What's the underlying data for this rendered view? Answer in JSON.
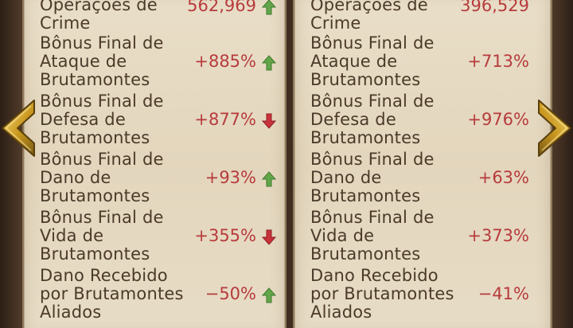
{
  "left_panel": {
    "rows": [
      {
        "label": "Operações de\nCrime",
        "value": "562,969",
        "trend": "up",
        "trend_icon": "green-up-arrow-icon"
      },
      {
        "label": "Bônus Final de\nAtaque de\nBrutamontes",
        "value": "+885%",
        "trend": "up",
        "trend_icon": "green-up-arrow-icon"
      },
      {
        "label": "Bônus Final de\nDefesa de\nBrutamontes",
        "value": "+877%",
        "trend": "down",
        "trend_icon": "red-down-arrow-icon"
      },
      {
        "label": "Bônus Final de\nDano de\nBrutamontes",
        "value": "+93%",
        "trend": "up",
        "trend_icon": "green-up-arrow-icon"
      },
      {
        "label": "Bônus Final de\nVida de\nBrutamontes",
        "value": "+355%",
        "trend": "down",
        "trend_icon": "red-down-arrow-icon"
      },
      {
        "label": "Dano Recebido\npor Brutamontes\nAliados",
        "value": "−50%",
        "trend": "up",
        "trend_icon": "green-up-arrow-icon"
      }
    ]
  },
  "right_panel": {
    "rows": [
      {
        "label": "Operações de\nCrime",
        "value": "396,529"
      },
      {
        "label": "Bônus Final de\nAtaque de\nBrutamontes",
        "value": "+713%"
      },
      {
        "label": "Bônus Final de\nDefesa de\nBrutamontes",
        "value": "+976%"
      },
      {
        "label": "Bônus Final de\nDano de\nBrutamontes",
        "value": "+63%"
      },
      {
        "label": "Bônus Final de\nVida de\nBrutamontes",
        "value": "+373%"
      },
      {
        "label": "Dano Recebido\npor Brutamontes\nAliados",
        "value": "−41%"
      }
    ]
  },
  "navigation": {
    "previous_icon": "gold-chevron-left-icon",
    "next_icon": "gold-chevron-right-icon"
  },
  "colors": {
    "parchment": "#e6dac3",
    "label_text": "#4b3a29",
    "value_text": "#b73b3c",
    "trend_up": "#62a64a",
    "trend_down": "#c8323a",
    "nav_gold": "#d2a52a"
  }
}
